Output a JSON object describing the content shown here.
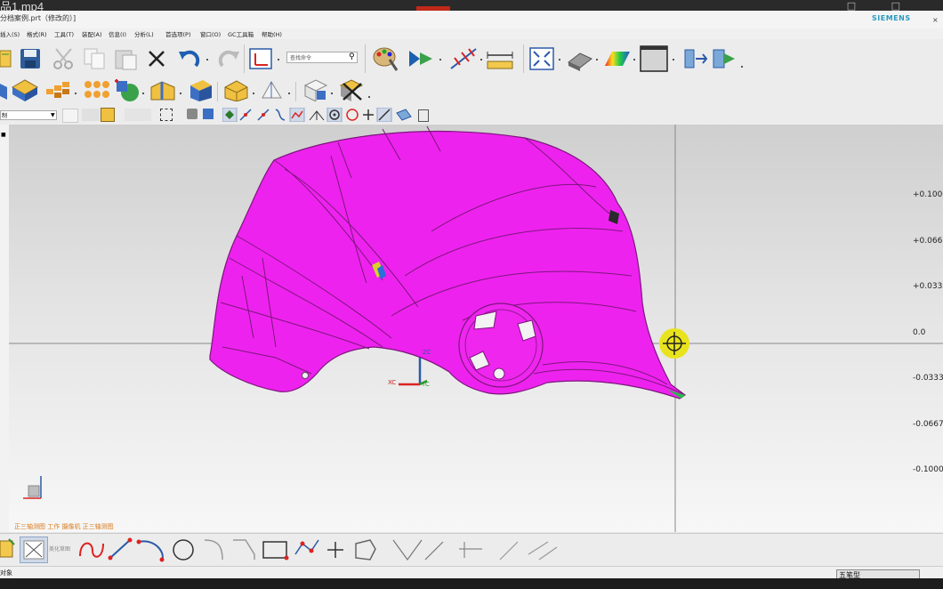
{
  "video": {
    "title": "品1.mp4"
  },
  "app": {
    "window_title": "分档案例.prt（修改的）]",
    "brand": "SIEMENS"
  },
  "menu": [
    "插入(S)",
    "格式(R)",
    "工具(T)",
    "装配(A)",
    "信息(I)",
    "分析(L)",
    "首选项(P)",
    "窗口(O)",
    "GC工具箱",
    "帮助(H)"
  ],
  "toolbar": {
    "search_placeholder": "查找命令",
    "selection_filter": "制"
  },
  "viewport": {
    "model_color": "#ee22ee",
    "y_ticks": [
      "+0.1000",
      "+0.0667",
      "+0.0333",
      "0.0",
      "-0.0333",
      "-0.0667",
      "-0.1000"
    ],
    "triad_labels": {
      "xc": "XC",
      "yc": "YC",
      "zc": "ZC"
    },
    "view_label": "正三轴测图 工作 摄像机 正三轴测图",
    "sketch_label": "美化草图"
  },
  "status": {
    "prompt": "对象",
    "ime_label": "五笔型"
  }
}
